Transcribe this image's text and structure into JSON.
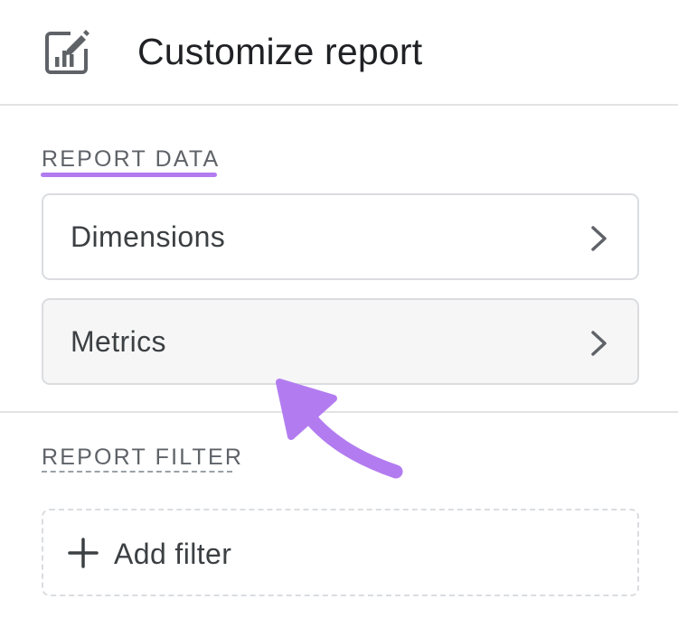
{
  "header": {
    "title": "Customize report",
    "icon": "edit-chart-icon"
  },
  "report_data": {
    "label": "REPORT DATA",
    "accent_color": "#b27cf0",
    "items": [
      {
        "label": "Dimensions",
        "icon": "chevron-right-icon"
      },
      {
        "label": "Metrics",
        "icon": "chevron-right-icon"
      }
    ]
  },
  "report_filter": {
    "label": "REPORT FILTER",
    "add_filter_label": "Add filter",
    "add_icon": "plus-icon"
  },
  "annotation": {
    "color": "#b27cf0",
    "icon": "pointer-arrow"
  }
}
